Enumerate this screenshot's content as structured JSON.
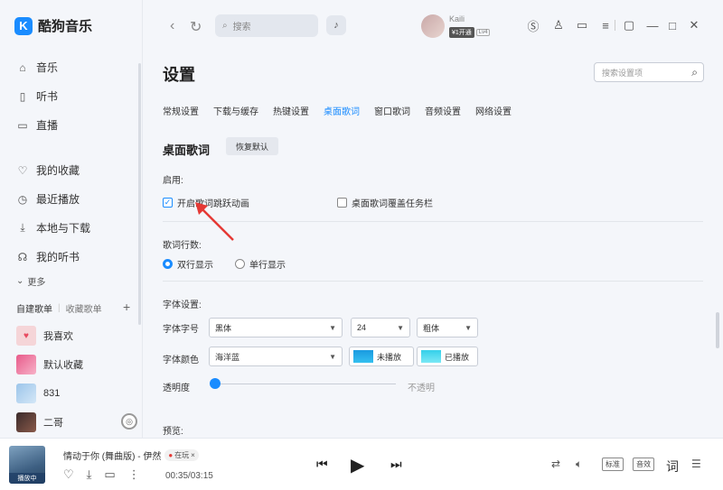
{
  "app": {
    "name": "酷狗音乐",
    "logo_letter": "K"
  },
  "sidebar": {
    "nav": [
      {
        "label": "音乐",
        "icon": "home-icon"
      },
      {
        "label": "听书",
        "icon": "book-icon"
      },
      {
        "label": "直播",
        "icon": "tv-icon"
      },
      {
        "label": "我的收藏",
        "icon": "heart-icon"
      },
      {
        "label": "最近播放",
        "icon": "clock-icon"
      },
      {
        "label": "本地与下载",
        "icon": "download-icon"
      },
      {
        "label": "我的听书",
        "icon": "headphones-icon"
      }
    ],
    "more": "更多",
    "playlist_tabs": {
      "created": "自建歌单",
      "collected": "收藏歌单"
    },
    "playlists": [
      {
        "label": "我喜欢",
        "color": "#f5d5d8"
      },
      {
        "label": "默认收藏",
        "color": "#e85a8a"
      },
      {
        "label": "831",
        "color": "#9cc5ea"
      },
      {
        "label": "二哥",
        "color": "#3a2a2a"
      }
    ]
  },
  "topbar": {
    "search_placeholder": "搜索",
    "username": "Kaili",
    "vip_label": "¥1开通",
    "level": "Lv4"
  },
  "settings": {
    "title": "设置",
    "search_placeholder": "搜索设置项",
    "tabs": [
      "常规设置",
      "下载与缓存",
      "热键设置",
      "桌面歌词",
      "窗口歌词",
      "音频设置",
      "网络设置"
    ],
    "active_tab": 3,
    "section_title": "桌面歌词",
    "reset_label": "恢复默认",
    "enable_label": "启用:",
    "enable_options": [
      {
        "label": "开启歌词跳跃动画",
        "checked": true
      },
      {
        "label": "桌面歌词覆盖任务栏",
        "checked": false
      }
    ],
    "lines_label": "歌词行数:",
    "lines_options": [
      {
        "label": "双行显示",
        "selected": true
      },
      {
        "label": "单行显示",
        "selected": false
      }
    ],
    "font_settings_label": "字体设置:",
    "font_size_label": "字体字号",
    "font_family_value": "黑体",
    "font_size_value": "24",
    "font_weight_value": "粗体",
    "font_color_label": "字体颜色",
    "font_color_value": "海洋蓝",
    "unplayed_label": "未播放",
    "played_label": "已播放",
    "opacity_label": "透明度",
    "opacity_value": 0,
    "opaque_label": "不透明",
    "preview_label": "预览:"
  },
  "player": {
    "cover_tag": "播放中",
    "song": "情动于你 (舞曲版) - 伊然",
    "listening": "在玩",
    "time": "00:35/03:15",
    "quality_label": "标准",
    "effect_label": "音效",
    "lyrics_label": "词"
  },
  "colors": {
    "accent": "#1a8cff",
    "unplayed_swatch": "#1fa8e8",
    "played_swatch": "#4fd8ec"
  }
}
